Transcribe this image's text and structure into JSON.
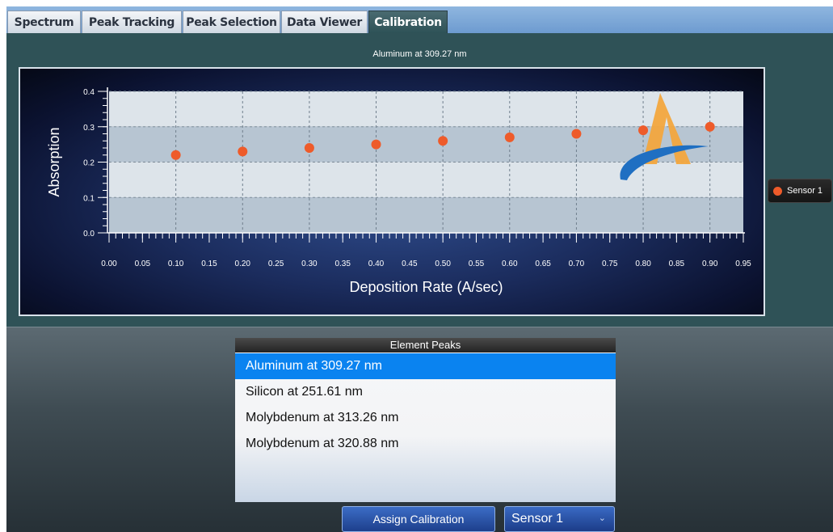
{
  "tabs": [
    {
      "label": "Spectrum",
      "active": false
    },
    {
      "label": "Peak Tracking",
      "active": false
    },
    {
      "label": "Peak Selection",
      "active": false
    },
    {
      "label": "Data Viewer",
      "active": false
    },
    {
      "label": "Calibration",
      "active": true
    }
  ],
  "chart_data": {
    "type": "scatter",
    "title": "Aluminum at 309.27 nm",
    "xlabel": "Deposition Rate (A/sec)",
    "ylabel": "Absorption",
    "xlim": [
      0.0,
      0.95
    ],
    "ylim": [
      0.0,
      0.4
    ],
    "xticks": [
      "0.00",
      "0.05",
      "0.10",
      "0.15",
      "0.20",
      "0.25",
      "0.30",
      "0.35",
      "0.40",
      "0.45",
      "0.50",
      "0.55",
      "0.60",
      "0.65",
      "0.70",
      "0.75",
      "0.80",
      "0.85",
      "0.90",
      "0.95"
    ],
    "yticks": [
      "0.0",
      "0.1",
      "0.2",
      "0.3",
      "0.4"
    ],
    "grid": true,
    "legend_position": "right",
    "series": [
      {
        "name": "Sensor 1",
        "color": "#ee5b2a",
        "x": [
          0.1,
          0.2,
          0.3,
          0.4,
          0.5,
          0.6,
          0.7,
          0.8,
          0.9
        ],
        "y": [
          0.22,
          0.23,
          0.24,
          0.25,
          0.26,
          0.27,
          0.28,
          0.29,
          0.3
        ]
      }
    ]
  },
  "element_peaks": {
    "header": "Element Peaks",
    "items": [
      {
        "label": "Aluminum at 309.27 nm",
        "selected": true
      },
      {
        "label": "Silicon at 251.61 nm",
        "selected": false
      },
      {
        "label": "Molybdenum at 313.26 nm",
        "selected": false
      },
      {
        "label": "Molybdenum at 320.88 nm",
        "selected": false
      }
    ]
  },
  "assign_button": "Assign Calibration",
  "sensor_select": {
    "value": "Sensor 1",
    "icon": "chevron-down-icon"
  },
  "logo": {
    "name": "logo-icon",
    "colors": [
      "#f2a63e",
      "#1f6fc2"
    ]
  }
}
